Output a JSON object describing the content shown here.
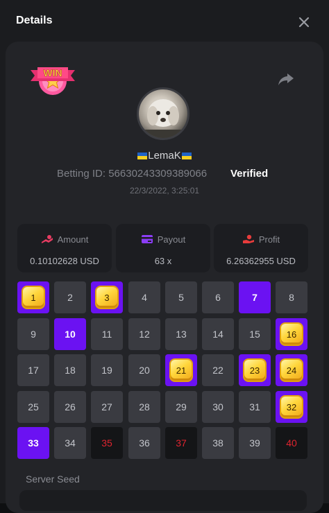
{
  "dialog": {
    "title": "Details"
  },
  "player": {
    "username": "LemaK",
    "betting_id_label": "Betting ID:",
    "betting_id": "56630243309389066",
    "verified": "Verified",
    "datetime": "22/3/2022, 3:25:01"
  },
  "badge": {
    "text": "WIN"
  },
  "stats": [
    {
      "label": "Amount",
      "value": "0.10102628 USD",
      "icon": "coins-icon"
    },
    {
      "label": "Payout",
      "value": "63 x",
      "icon": "card-icon"
    },
    {
      "label": "Profit",
      "value": "6.26362955 USD",
      "icon": "hand-coin-icon"
    }
  ],
  "tiles": [
    {
      "n": "1",
      "state": "gem"
    },
    {
      "n": "2",
      "state": "normal"
    },
    {
      "n": "3",
      "state": "gem"
    },
    {
      "n": "4",
      "state": "normal"
    },
    {
      "n": "5",
      "state": "normal"
    },
    {
      "n": "6",
      "state": "normal"
    },
    {
      "n": "7",
      "state": "selected"
    },
    {
      "n": "8",
      "state": "normal"
    },
    {
      "n": "9",
      "state": "normal"
    },
    {
      "n": "10",
      "state": "selected"
    },
    {
      "n": "11",
      "state": "normal"
    },
    {
      "n": "12",
      "state": "normal"
    },
    {
      "n": "13",
      "state": "normal"
    },
    {
      "n": "14",
      "state": "normal"
    },
    {
      "n": "15",
      "state": "normal"
    },
    {
      "n": "16",
      "state": "gem"
    },
    {
      "n": "17",
      "state": "normal"
    },
    {
      "n": "18",
      "state": "normal"
    },
    {
      "n": "19",
      "state": "normal"
    },
    {
      "n": "20",
      "state": "normal"
    },
    {
      "n": "21",
      "state": "gem"
    },
    {
      "n": "22",
      "state": "normal"
    },
    {
      "n": "23",
      "state": "gem"
    },
    {
      "n": "24",
      "state": "gem"
    },
    {
      "n": "25",
      "state": "normal"
    },
    {
      "n": "26",
      "state": "normal"
    },
    {
      "n": "27",
      "state": "normal"
    },
    {
      "n": "28",
      "state": "normal"
    },
    {
      "n": "29",
      "state": "normal"
    },
    {
      "n": "30",
      "state": "normal"
    },
    {
      "n": "31",
      "state": "normal"
    },
    {
      "n": "32",
      "state": "gem"
    },
    {
      "n": "33",
      "state": "selected"
    },
    {
      "n": "34",
      "state": "normal"
    },
    {
      "n": "35",
      "state": "drawn"
    },
    {
      "n": "36",
      "state": "normal"
    },
    {
      "n": "37",
      "state": "drawn"
    },
    {
      "n": "38",
      "state": "normal"
    },
    {
      "n": "39",
      "state": "normal"
    },
    {
      "n": "40",
      "state": "drawn"
    }
  ],
  "seed": {
    "server_seed_label": "Server Seed"
  },
  "colors": {
    "accent_purple": "#6b12f2",
    "drawn_red": "#e0242f",
    "gem_gold": "#ffd53b"
  }
}
